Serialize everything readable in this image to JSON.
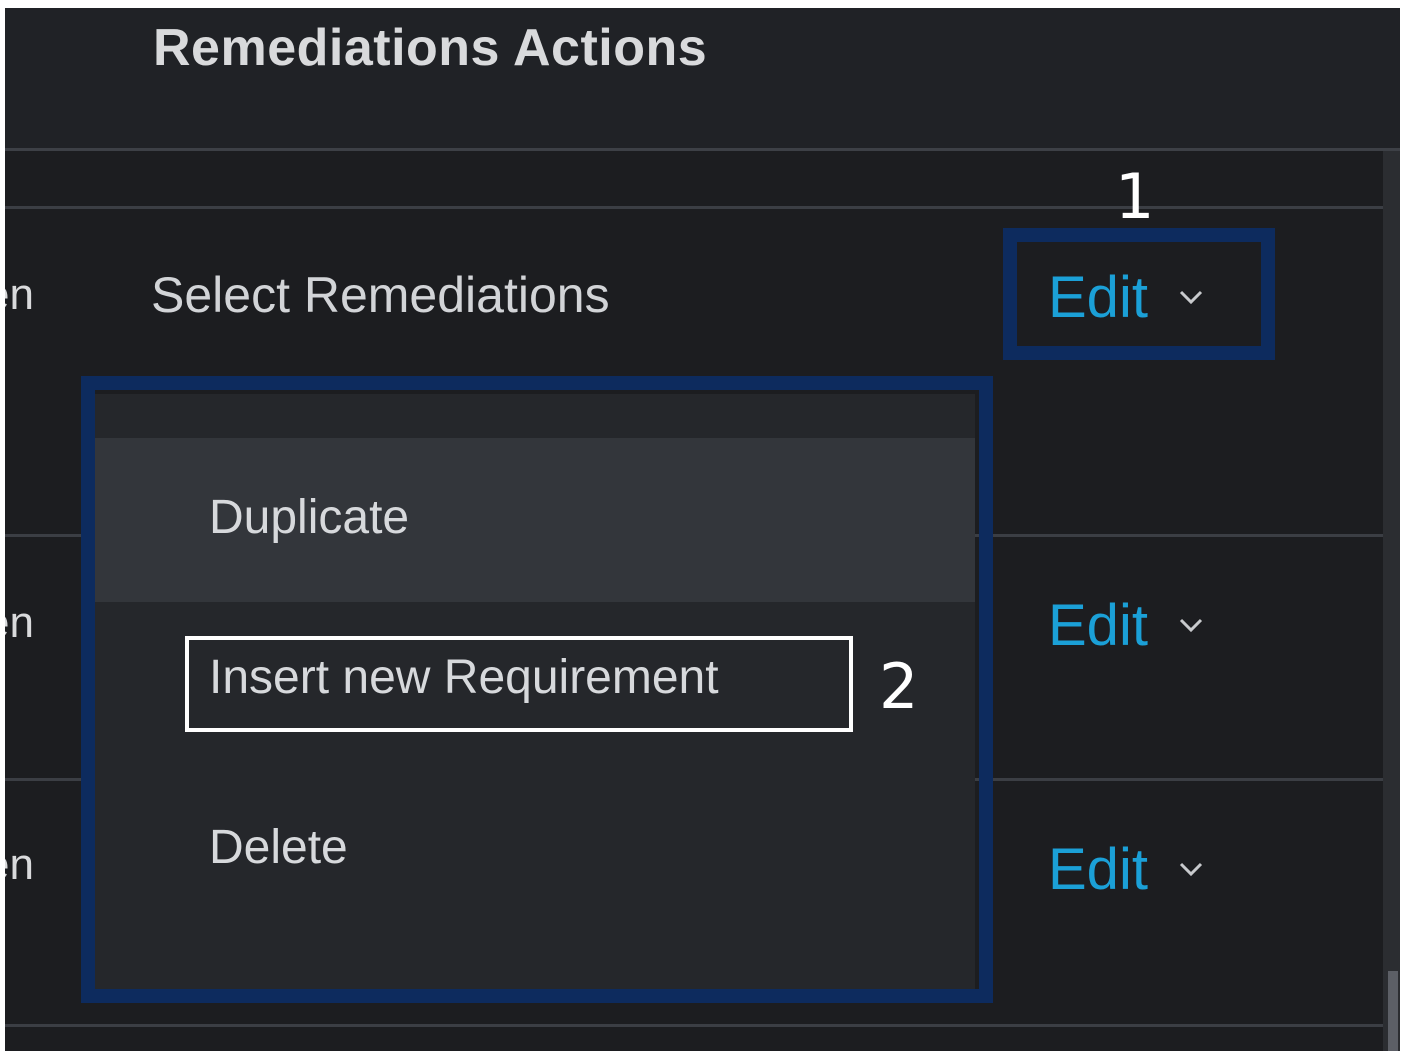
{
  "header": {
    "title": "Remediations Actions"
  },
  "rows": [
    {
      "cut_text": "en",
      "label": "Select Remediations",
      "edit_label": "Edit"
    },
    {
      "cut_text": "en",
      "edit_label": "Edit"
    },
    {
      "cut_text": "en",
      "edit_label": "Edit"
    }
  ],
  "dropdown": {
    "items": [
      {
        "label": "Duplicate",
        "state": "hover"
      },
      {
        "label": "Insert new Requirement",
        "state": "highlighted"
      },
      {
        "label": "Delete",
        "state": "normal"
      }
    ]
  },
  "annotations": {
    "step1": "1",
    "step2": "2"
  },
  "colors": {
    "background": "#1c1d20",
    "header": "#202226",
    "dropdown": "#25272b",
    "dropdown_hover": "#33363b",
    "link": "#1ba0d7",
    "callout_border": "#0d2b5e",
    "text": "#d9dadc"
  },
  "icons": {
    "edit_chevron": "chevron-down-icon"
  }
}
